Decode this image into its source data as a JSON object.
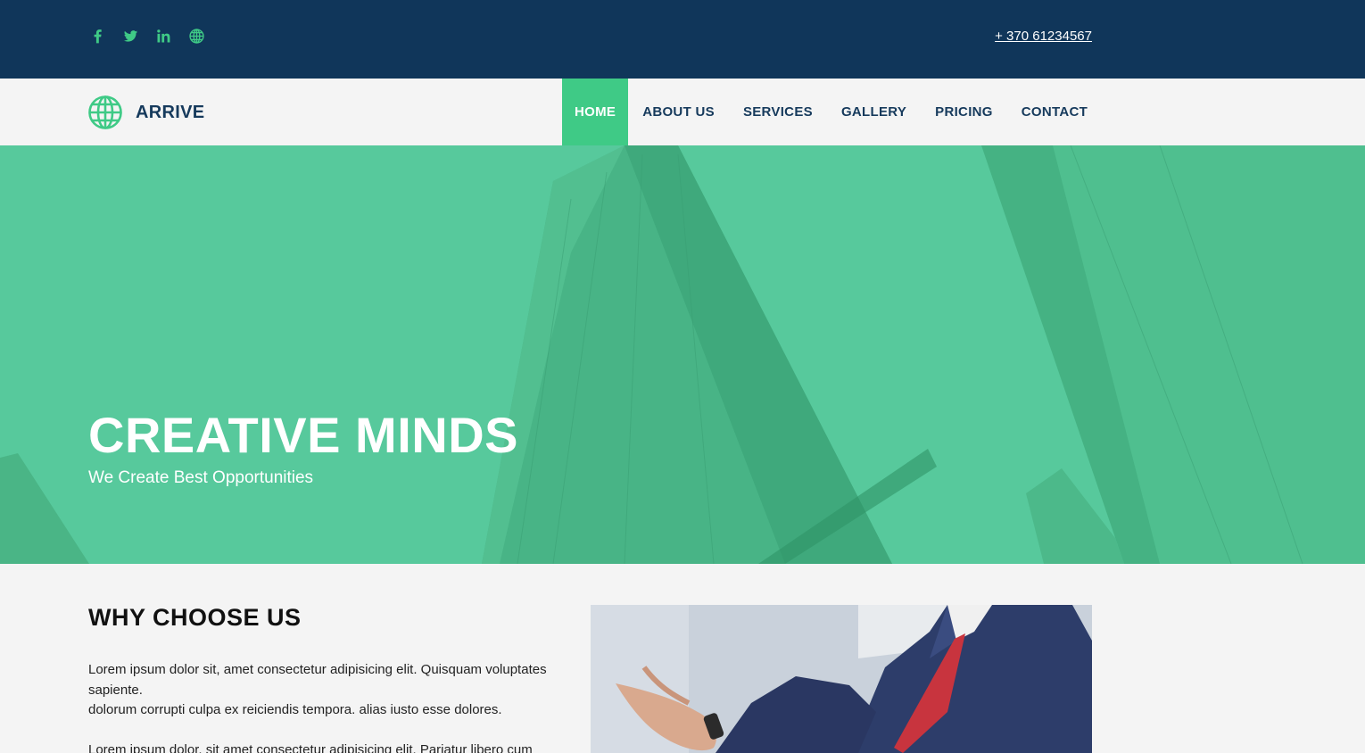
{
  "topbar": {
    "social_icons": [
      "facebook-icon",
      "twitter-icon",
      "linkedin-icon",
      "globe-icon"
    ],
    "phone": "+ 370 61234567"
  },
  "brand": {
    "name": "ARRIVE",
    "icon": "globe-icon"
  },
  "nav": {
    "items": [
      {
        "label": "HOME",
        "active": true
      },
      {
        "label": "ABOUT US"
      },
      {
        "label": "SERVICES"
      },
      {
        "label": "GALLERY"
      },
      {
        "label": "PRICING"
      },
      {
        "label": "CONTACT"
      }
    ]
  },
  "hero": {
    "title": "CREATIVE MINDS",
    "subtitle": "We Create Best Opportunities"
  },
  "why": {
    "title": "WHY CHOOSE US",
    "paragraph1_line1": "Lorem ipsum dolor sit, amet consectetur adipisicing elit. Quisquam voluptates sapiente.",
    "paragraph1_line2": "dolorum corrupti culpa ex reiciendis tempora. alias iusto esse dolores.",
    "paragraph2": "Lorem ipsum dolor, sit amet consectetur adipisicing elit. Pariatur libero cum"
  },
  "colors": {
    "topbar": "#10365a",
    "accent": "#3fca86",
    "nav_text": "#163a5c",
    "hero_overlay": "#57c99c"
  }
}
